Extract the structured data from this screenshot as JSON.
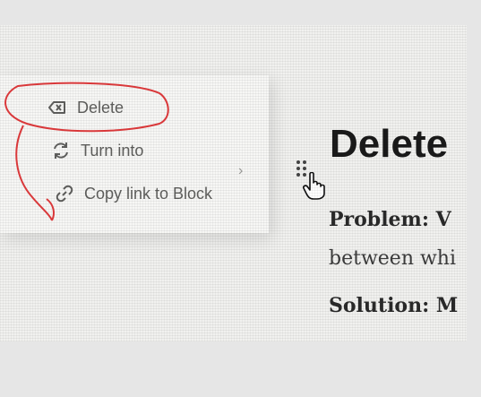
{
  "context_menu": {
    "items": [
      {
        "label": "Delete",
        "icon": "delete-backspace-icon"
      },
      {
        "label": "Turn into",
        "icon": "refresh-icon",
        "submenu_indicator": "›"
      },
      {
        "label": "Copy link to Block",
        "icon": "link-icon"
      }
    ]
  },
  "block": {
    "drag_handle_icon": "drag-handle-icon",
    "heading": "Delete",
    "problem_label": "Problem: V",
    "problem_text": "between whi",
    "solution_label": "Solution: M"
  },
  "annotation": {
    "color": "#d9383a",
    "icon": "hand-pointer-cursor-icon"
  }
}
